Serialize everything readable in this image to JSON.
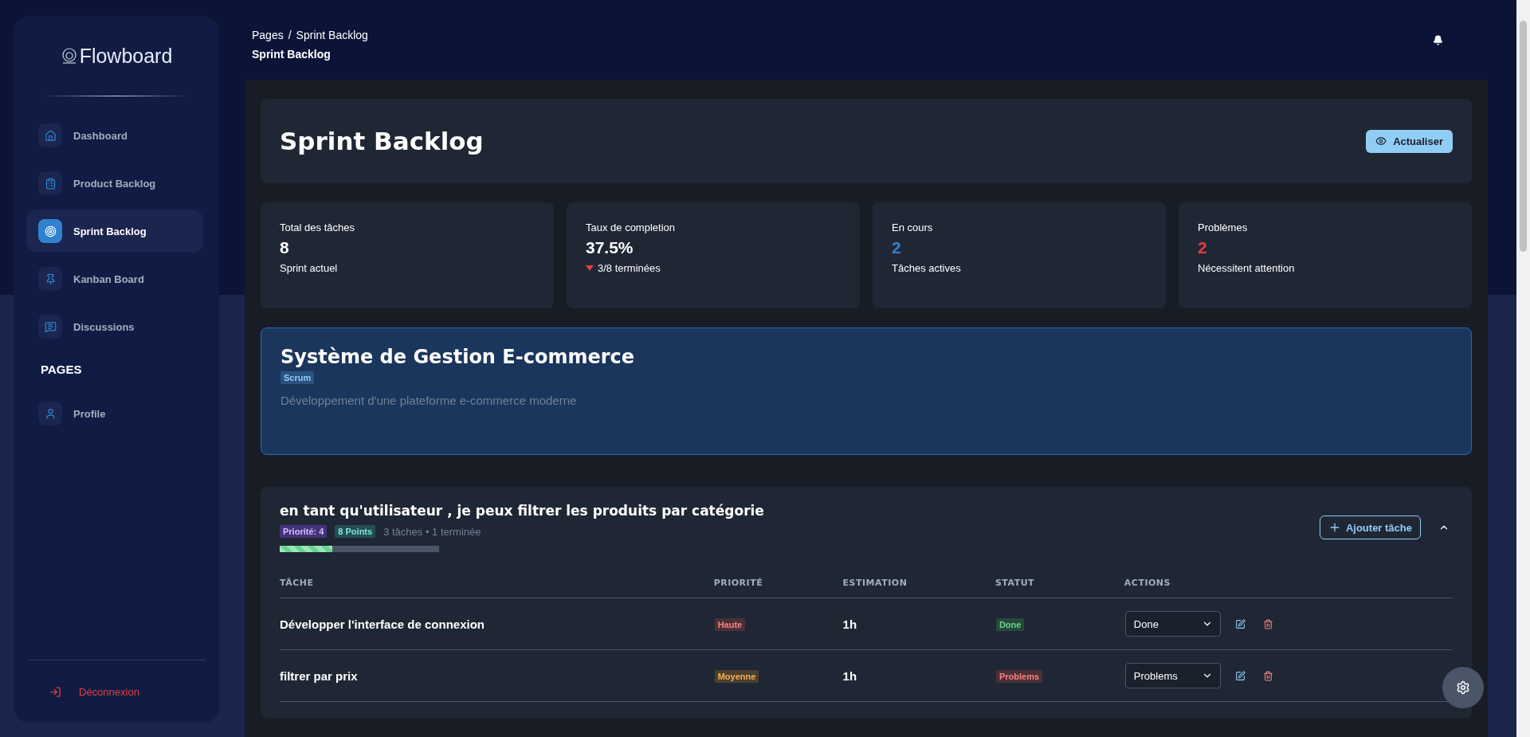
{
  "sidebar": {
    "brand": "Flowboard",
    "items": [
      {
        "kind": "home",
        "label": "Dashboard",
        "selected": false
      },
      {
        "kind": "clipboard",
        "label": "Product Backlog",
        "selected": false
      },
      {
        "kind": "target",
        "label": "Sprint Backlog",
        "selected": true
      },
      {
        "kind": "pin",
        "label": "Kanban Board",
        "selected": false
      },
      {
        "kind": "chat",
        "label": "Discussions",
        "selected": false
      }
    ],
    "section_title": "PAGES",
    "pages": [
      {
        "kind": "user",
        "label": "Profile",
        "selected": false
      }
    ],
    "logout": "Déconnexion"
  },
  "header": {
    "breadcrumb_root": "Pages",
    "breadcrumb_separator": "/",
    "breadcrumb_current": "Sprint Backlog",
    "page_title": "Sprint Backlog"
  },
  "title_card": {
    "title": "Sprint Backlog",
    "button": "Actualiser"
  },
  "stats": [
    {
      "label": "Total des tâches",
      "value": "8",
      "color": "#ffffff",
      "note": "Sprint actuel",
      "falling": false
    },
    {
      "label": "Taux de completion",
      "value": "37.5%",
      "color": "#ffffff",
      "note": "3/8 terminées",
      "falling": true
    },
    {
      "label": "En cours",
      "value": "2",
      "color": "#3182ce",
      "note": "Tâches actives",
      "falling": false
    },
    {
      "label": "Problèmes",
      "value": "2",
      "color": "#e53e3e",
      "note": "Nécessitent attention",
      "falling": false
    }
  ],
  "project": {
    "name": "Système de Gestion E-commerce",
    "method": "Scrum",
    "description": "Développement d'une plateforme e-commerce moderne"
  },
  "story": {
    "title": "en tant qu'utilisateur , je peux filtrer les produits par catégorie",
    "priority": "Priorité: 4",
    "points": "8 Points",
    "summary": "3 tâches • 1 terminée",
    "level": 0.33,
    "add_button": "Ajouter tâche",
    "expanded": true,
    "columns": [
      "TÂCHE",
      "PRIORITÉ",
      "ESTIMATION",
      "STATUT",
      "ACTIONS"
    ],
    "rows": [
      {
        "task": "Développer l'interface de connexion",
        "priority": {
          "label": "Haute",
          "kind": "high"
        },
        "estimate": "1h",
        "status": {
          "label": "Done",
          "kind": "done"
        },
        "select": "Done"
      },
      {
        "task": "filtrer par prix",
        "priority": {
          "label": "Moyenne",
          "kind": "medium"
        },
        "estimate": "1h",
        "status": {
          "label": "Problems",
          "kind": "problems"
        },
        "select": "Problems"
      }
    ]
  }
}
